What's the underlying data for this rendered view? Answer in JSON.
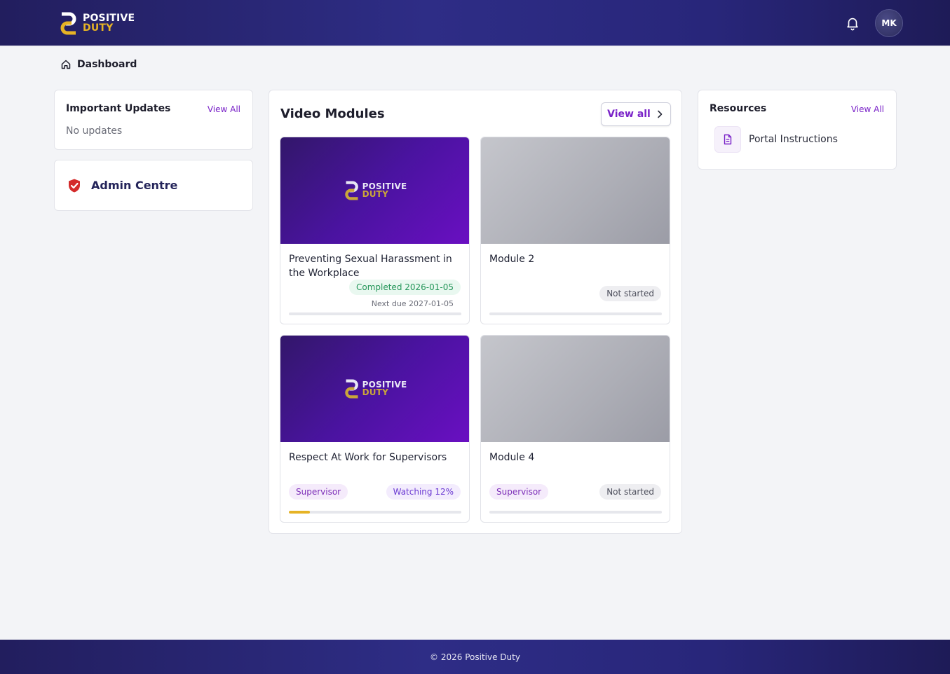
{
  "brand": {
    "line1": "POSITIVE",
    "line2": "DUTY",
    "accent": "#e6b325",
    "primary": "#2e2d86",
    "link": "#7a23c8"
  },
  "header": {
    "notifications_icon": "bell-icon",
    "avatar_initials": "MK"
  },
  "breadcrumb": {
    "icon": "home-icon",
    "label": "Dashboard"
  },
  "updates": {
    "title": "Important Updates",
    "view_all": "View All",
    "empty": "No updates"
  },
  "admin": {
    "icon": "shield-check-icon",
    "label": "Admin Centre"
  },
  "modules": {
    "title": "Video Modules",
    "view_all": "View all",
    "items": [
      {
        "title": "Preventing Sexual Harassment in the Workplace",
        "thumbnail": "brand",
        "status": "Completed 2026-01-05",
        "status_color": "#25965a",
        "next_due": "Next due 2027-01-05",
        "progress": 0
      },
      {
        "title": "Module 2",
        "thumbnail": "grey",
        "status": "Not started",
        "progress": 0
      },
      {
        "title": "Respect At Work for Supervisors",
        "thumbnail": "brand",
        "role": "Supervisor",
        "status": "Watching 12%",
        "progress": 0.12
      },
      {
        "title": "Module 4",
        "thumbnail": "grey",
        "role": "Supervisor",
        "status": "Not started",
        "progress": 0
      }
    ]
  },
  "resources": {
    "title": "Resources",
    "view_all": "View All",
    "items": [
      {
        "label": "Portal Instructions",
        "icon": "document-icon"
      }
    ]
  },
  "footer": {
    "text": "© 2026 Positive Duty"
  }
}
